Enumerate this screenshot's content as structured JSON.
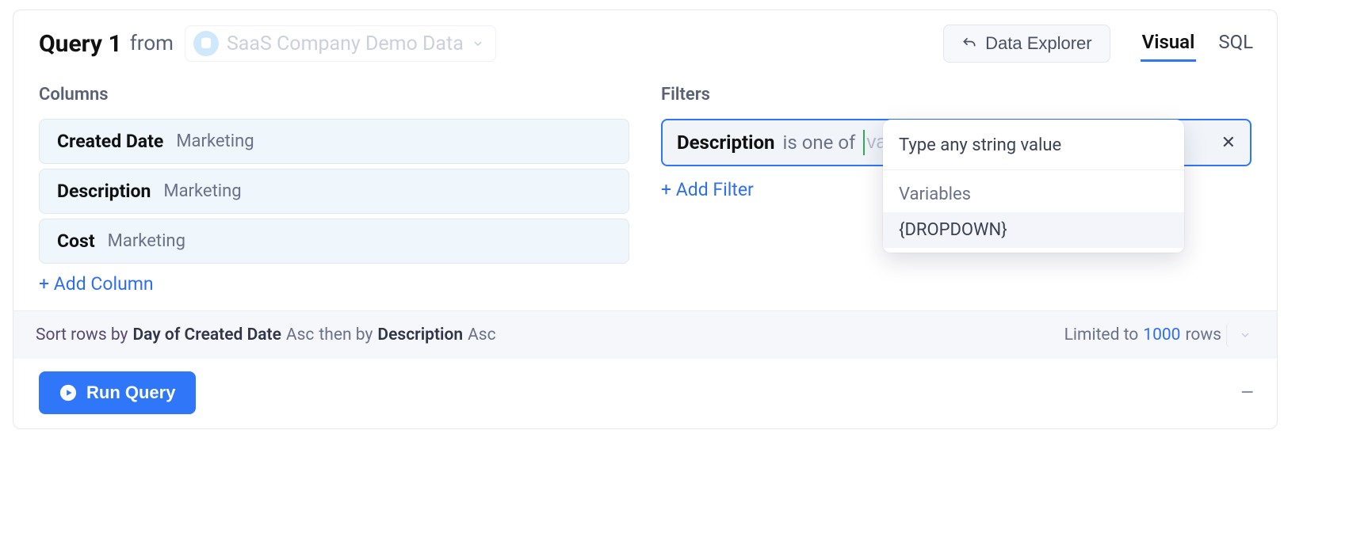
{
  "header": {
    "query_title": "Query 1",
    "from_label": "from",
    "datasource": "SaaS Company Demo Data",
    "data_explorer_label": "Data Explorer",
    "tabs": {
      "visual": "Visual",
      "sql": "SQL",
      "active": "visual"
    }
  },
  "columns": {
    "heading": "Columns",
    "items": [
      {
        "name": "Created Date",
        "tag": "Marketing"
      },
      {
        "name": "Description",
        "tag": "Marketing"
      },
      {
        "name": "Cost",
        "tag": "Marketing"
      }
    ],
    "add_label": "+ Add Column"
  },
  "filters": {
    "heading": "Filters",
    "editor": {
      "field": "Description",
      "operator": "is one of",
      "value_placeholder": "value",
      "clear_glyph": "✕"
    },
    "add_label": "+ Add Filter",
    "popup": {
      "input_hint": "Type any string value",
      "variables_label": "Variables",
      "items": [
        "{DROPDOWN}"
      ]
    }
  },
  "sort": {
    "prefix": "Sort rows by",
    "primary": "Day of Created Date",
    "primary_dir": "Asc",
    "then": "then by",
    "secondary": "Description",
    "secondary_dir": "Asc",
    "limit_prefix": "Limited to",
    "limit_value": "1000",
    "limit_suffix": "rows"
  },
  "run": {
    "label": "Run Query",
    "collapse_glyph": "–"
  }
}
